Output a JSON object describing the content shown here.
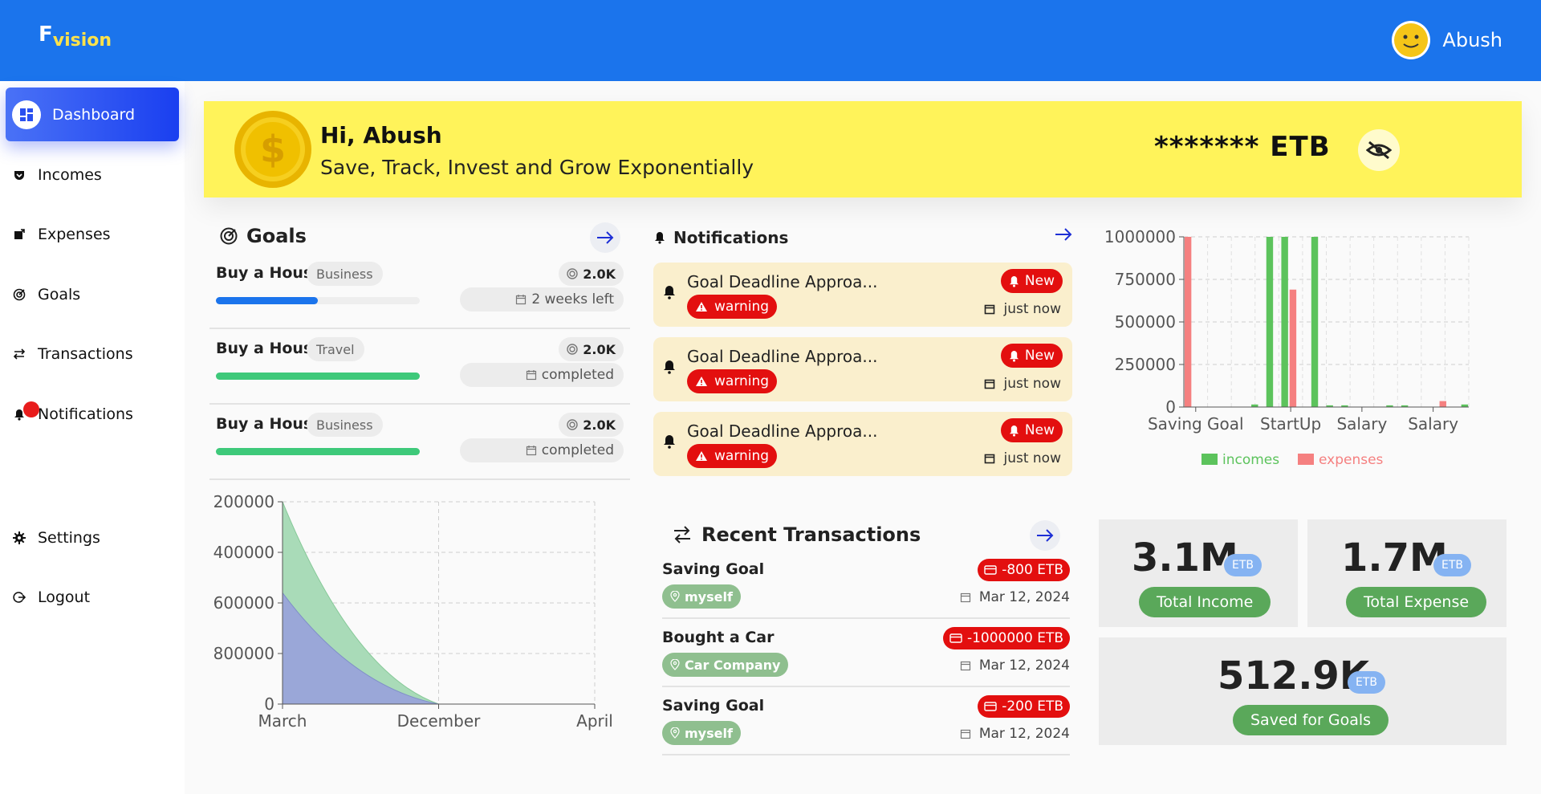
{
  "header": {
    "logo_f": "F",
    "logo_rest": "vision",
    "user_name": "Abush"
  },
  "sidebar": {
    "items": [
      {
        "label": "Dashboard",
        "icon": "dashboard-icon",
        "active": true
      },
      {
        "label": "Incomes",
        "icon": "pocket-icon"
      },
      {
        "label": "Expenses",
        "icon": "export-icon"
      },
      {
        "label": "Goals",
        "icon": "target-icon"
      },
      {
        "label": "Transactions",
        "icon": "swap-icon"
      },
      {
        "label": "Notifications",
        "icon": "bell-icon"
      },
      {
        "label": "Settings",
        "icon": "gear-icon"
      },
      {
        "label": "Logout",
        "icon": "logout-icon"
      }
    ]
  },
  "banner": {
    "greeting": "Hi, Abush",
    "tagline": "Save, Track, Invest and Grow Exponentially",
    "balance": "******* ETB"
  },
  "goals": {
    "title": "Goals",
    "items": [
      {
        "name": "Buy a Hous",
        "category": "Business",
        "amount": "2.0K",
        "status": "2 weeks left",
        "progress": 0.5,
        "bar_color": "#1b74ec"
      },
      {
        "name": "Buy a Hous",
        "category": "Travel",
        "amount": "2.0K",
        "status": "completed",
        "progress": 1.0,
        "bar_color": "#3ec97a"
      },
      {
        "name": "Buy a Hous",
        "category": "Business",
        "amount": "2.0K",
        "status": "completed",
        "progress": 1.0,
        "bar_color": "#3ec97a"
      }
    ]
  },
  "notifications": {
    "title": "Notifications",
    "items": [
      {
        "text": "Goal Deadline Approa...",
        "type": "warning",
        "badge": "New",
        "time": "just now"
      },
      {
        "text": "Goal Deadline Approa...",
        "type": "warning",
        "badge": "New",
        "time": "just now"
      },
      {
        "text": "Goal Deadline Approa...",
        "type": "warning",
        "badge": "New",
        "time": "just now"
      }
    ]
  },
  "transactions": {
    "title": "Recent Transactions",
    "items": [
      {
        "name": "Saving Goal",
        "tag": "myself",
        "amount": "-800 ETB",
        "date": "Mar 12, 2024"
      },
      {
        "name": "Bought a Car",
        "tag": "Car Company",
        "amount": "-1000000 ETB",
        "date": "Mar 12, 2024"
      },
      {
        "name": "Saving Goal",
        "tag": "myself",
        "amount": "-200 ETB",
        "date": "Mar 12, 2024"
      }
    ]
  },
  "stats": {
    "income": {
      "value": "3.1M",
      "unit": "ETB",
      "label": "Total Income"
    },
    "expense": {
      "value": "1.7M",
      "unit": "ETB",
      "label": "Total Expense"
    },
    "saved": {
      "value": "512.9K",
      "unit": "ETB",
      "label": "Saved for Goals"
    }
  },
  "chart_data": [
    {
      "type": "area",
      "x": [
        "March",
        "December",
        "April"
      ],
      "yticks": [
        "200000",
        "400000",
        "600000",
        "800000",
        "0"
      ],
      "ylim": [
        0,
        200000
      ],
      "grid": true,
      "series": [
        {
          "values": [
            200000,
            0,
            0
          ],
          "color": "#a9dbb8"
        },
        {
          "values": [
            110000,
            0,
            0
          ],
          "color": "#9aa7d8"
        }
      ]
    },
    {
      "type": "bar",
      "categories": [
        "Saving Goal",
        "",
        "",
        "",
        "StartUp",
        "",
        "",
        "Salary",
        "",
        "",
        "Salary",
        ""
      ],
      "ylim": [
        0,
        1000000
      ],
      "yticks": [
        "0",
        "250000",
        "500000",
        "750000",
        "1000000"
      ],
      "grid": true,
      "legend_position": "bottom",
      "series": [
        {
          "name": "incomes",
          "color": "#5cc35c",
          "values": [
            0,
            0,
            0,
            0,
            15000,
            1000000,
            1000000,
            0,
            1000000,
            10000,
            10000,
            0,
            0,
            10000,
            10000,
            0,
            0,
            0,
            15000
          ]
        },
        {
          "name": "expenses",
          "color": "#f58080",
          "values": [
            1000000,
            0,
            0,
            0,
            0,
            0,
            0,
            690000,
            0,
            0,
            0,
            0,
            0,
            0,
            0,
            0,
            0,
            35000,
            0
          ]
        }
      ]
    }
  ]
}
